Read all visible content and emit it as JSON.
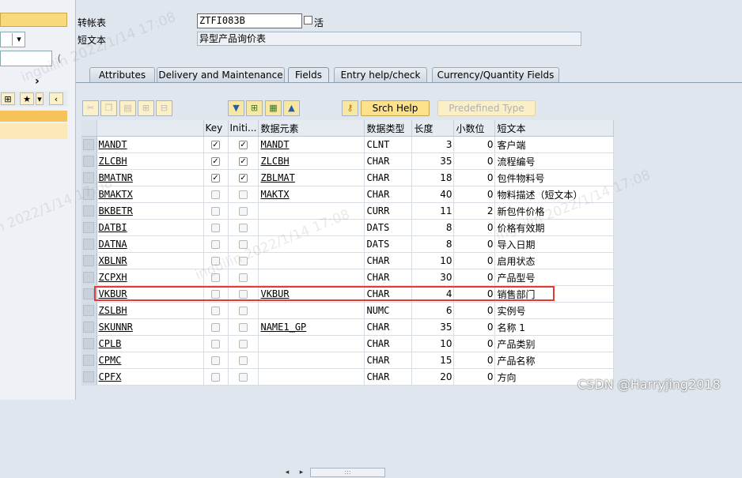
{
  "header": {
    "table_label": "转帐表",
    "table_name": "ZTFI083B",
    "status": "活",
    "short_text_label": "短文本",
    "short_text": "异型产品询价表"
  },
  "tabs": [
    {
      "label": "Attributes"
    },
    {
      "label": "Delivery and Maintenance"
    },
    {
      "label": "Fields",
      "active": true
    },
    {
      "label": "Entry help/check"
    },
    {
      "label": "Currency/Quantity Fields"
    }
  ],
  "toolbar": {
    "icons": [
      "cut-icon",
      "copy-icon",
      "paste-icon",
      "insert-row-icon",
      "delete-row-icon",
      "sort-down-icon",
      "insert-field-icon",
      "table-icon",
      "sort-up-icon",
      "key-icon"
    ],
    "srch_help": "Srch Help",
    "predefined_type": "Predefined Type"
  },
  "columns": {
    "field": "",
    "key": "Key",
    "init": "Initi...",
    "data_element": "数据元素",
    "data_type": "数据类型",
    "length": "长度",
    "decimals": "小数位",
    "short_text": "短文本"
  },
  "rows": [
    {
      "field": "MANDT",
      "key": true,
      "init": true,
      "de": "MANDT",
      "type": "CLNT",
      "len": "3",
      "dec": "0",
      "text": "客户端"
    },
    {
      "field": "ZLCBH",
      "key": true,
      "init": true,
      "de": "ZLCBH",
      "type": "CHAR",
      "len": "35",
      "dec": "0",
      "text": "流程编号"
    },
    {
      "field": "BMATNR",
      "key": true,
      "init": true,
      "de": "ZBLMAT",
      "type": "CHAR",
      "len": "18",
      "dec": "0",
      "text": "包件物料号"
    },
    {
      "field": "BMAKTX",
      "key": false,
      "init": false,
      "de": "MAKTX",
      "type": "CHAR",
      "len": "40",
      "dec": "0",
      "text": "物料描述（短文本）"
    },
    {
      "field": "BKBETR",
      "key": false,
      "init": false,
      "de": "",
      "type": "CURR",
      "len": "11",
      "dec": "2",
      "text": "新包件价格"
    },
    {
      "field": "DATBI",
      "key": false,
      "init": false,
      "de": "",
      "type": "DATS",
      "len": "8",
      "dec": "0",
      "text": "价格有效期"
    },
    {
      "field": "DATNA",
      "key": false,
      "init": false,
      "de": "",
      "type": "DATS",
      "len": "8",
      "dec": "0",
      "text": "导入日期"
    },
    {
      "field": "XBLNR",
      "key": false,
      "init": false,
      "de": "",
      "type": "CHAR",
      "len": "10",
      "dec": "0",
      "text": "启用状态"
    },
    {
      "field": "ZCPXH",
      "key": false,
      "init": false,
      "de": "",
      "type": "CHAR",
      "len": "30",
      "dec": "0",
      "text": "产品型号"
    },
    {
      "field": "VKBUR",
      "key": false,
      "init": false,
      "de": "VKBUR",
      "type": "CHAR",
      "len": "4",
      "dec": "0",
      "text": "销售部门"
    },
    {
      "field": "ZSLBH",
      "key": false,
      "init": false,
      "de": "",
      "type": "NUMC",
      "len": "6",
      "dec": "0",
      "text": "实例号"
    },
    {
      "field": "SKUNNR",
      "key": false,
      "init": false,
      "de": "NAME1_GP",
      "type": "CHAR",
      "len": "35",
      "dec": "0",
      "text": "名称 1"
    },
    {
      "field": "CPLB",
      "key": false,
      "init": false,
      "de": "",
      "type": "CHAR",
      "len": "10",
      "dec": "0",
      "text": "产品类别"
    },
    {
      "field": "CPMC",
      "key": false,
      "init": false,
      "de": "",
      "type": "CHAR",
      "len": "15",
      "dec": "0",
      "text": "产品名称"
    },
    {
      "field": "CPFX",
      "key": false,
      "init": false,
      "de": "",
      "type": "CHAR",
      "len": "20",
      "dec": "0",
      "text": "方向"
    }
  ],
  "watermark": {
    "user_date": "inguilin 2022/1/14 17:08",
    "csdn": "CSDN @Harryjing2018"
  },
  "colors": {
    "background": "#dfe6ee",
    "highlight": "#e53935",
    "button": "#fde18b"
  }
}
